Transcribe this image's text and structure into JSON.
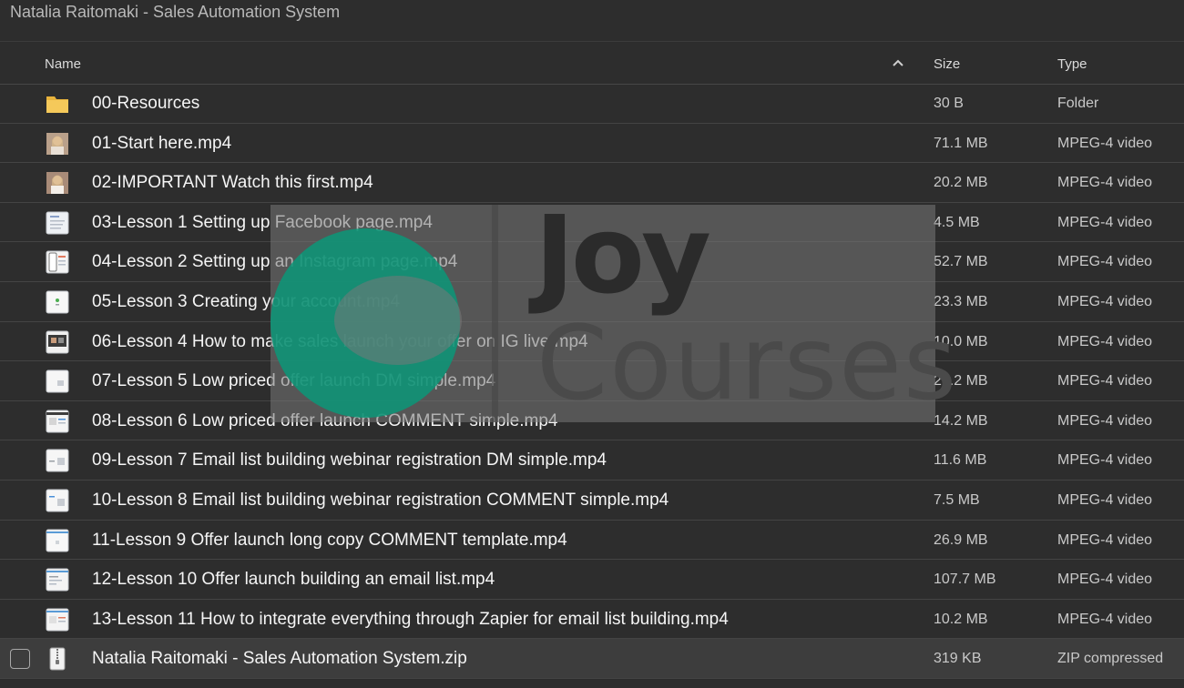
{
  "window": {
    "title": "Natalia Raitomaki - Sales Automation System"
  },
  "columns": {
    "name": "Name",
    "size": "Size",
    "type": "Type"
  },
  "files": [
    {
      "name": "00-Resources",
      "size": "30 B",
      "type": "Folder",
      "icon": "folder-icon"
    },
    {
      "name": "01-Start here.mp4",
      "size": "71.1 MB",
      "type": "MPEG-4 video",
      "icon": "video-thumbnail-icon"
    },
    {
      "name": "02-IMPORTANT Watch this first.mp4",
      "size": "20.2 MB",
      "type": "MPEG-4 video",
      "icon": "video-thumbnail-icon"
    },
    {
      "name": "03-Lesson 1 Setting up Facebook page.mp4",
      "size": "4.5 MB",
      "type": "MPEG-4 video",
      "icon": "video-thumbnail-icon"
    },
    {
      "name": "04-Lesson 2 Setting up an Instagram page.mp4",
      "size": "52.7 MB",
      "type": "MPEG-4 video",
      "icon": "video-thumbnail-icon"
    },
    {
      "name": "05-Lesson 3 Creating your account.mp4",
      "size": "23.3 MB",
      "type": "MPEG-4 video",
      "icon": "video-thumbnail-icon"
    },
    {
      "name": "06-Lesson 4 How to make sales launch your offer on IG live.mp4",
      "size": "10.0 MB",
      "type": "MPEG-4 video",
      "icon": "video-thumbnail-icon"
    },
    {
      "name": "07-Lesson 5 Low priced offer launch DM simple.mp4",
      "size": "21.2 MB",
      "type": "MPEG-4 video",
      "icon": "video-thumbnail-icon"
    },
    {
      "name": "08-Lesson 6 Low priced offer launch COMMENT simple.mp4",
      "size": "14.2 MB",
      "type": "MPEG-4 video",
      "icon": "video-thumbnail-icon"
    },
    {
      "name": "09-Lesson 7 Email list building webinar registration DM simple.mp4",
      "size": "11.6 MB",
      "type": "MPEG-4 video",
      "icon": "video-thumbnail-icon"
    },
    {
      "name": "10-Lesson 8 Email list building webinar registration COMMENT simple.mp4",
      "size": "7.5 MB",
      "type": "MPEG-4 video",
      "icon": "video-thumbnail-icon"
    },
    {
      "name": "11-Lesson 9 Offer launch long copy COMMENT template.mp4",
      "size": "26.9 MB",
      "type": "MPEG-4 video",
      "icon": "video-thumbnail-icon"
    },
    {
      "name": "12-Lesson 10 Offer launch building an email list.mp4",
      "size": "107.7 MB",
      "type": "MPEG-4 video",
      "icon": "video-thumbnail-icon"
    },
    {
      "name": "13-Lesson 11 How to integrate everything through Zapier for email list building.mp4",
      "size": "10.2 MB",
      "type": "MPEG-4 video",
      "icon": "video-thumbnail-icon"
    },
    {
      "name": "Natalia Raitomaki - Sales Automation System.zip",
      "size": "319 KB",
      "type": "ZIP compressed",
      "icon": "zip-icon"
    }
  ],
  "watermark": {
    "line1": "Joy",
    "line2": "Courses"
  },
  "colors": {
    "background": "#2d2d2d",
    "folder": "#f2c14e",
    "watermark_green": "#0a9678"
  }
}
